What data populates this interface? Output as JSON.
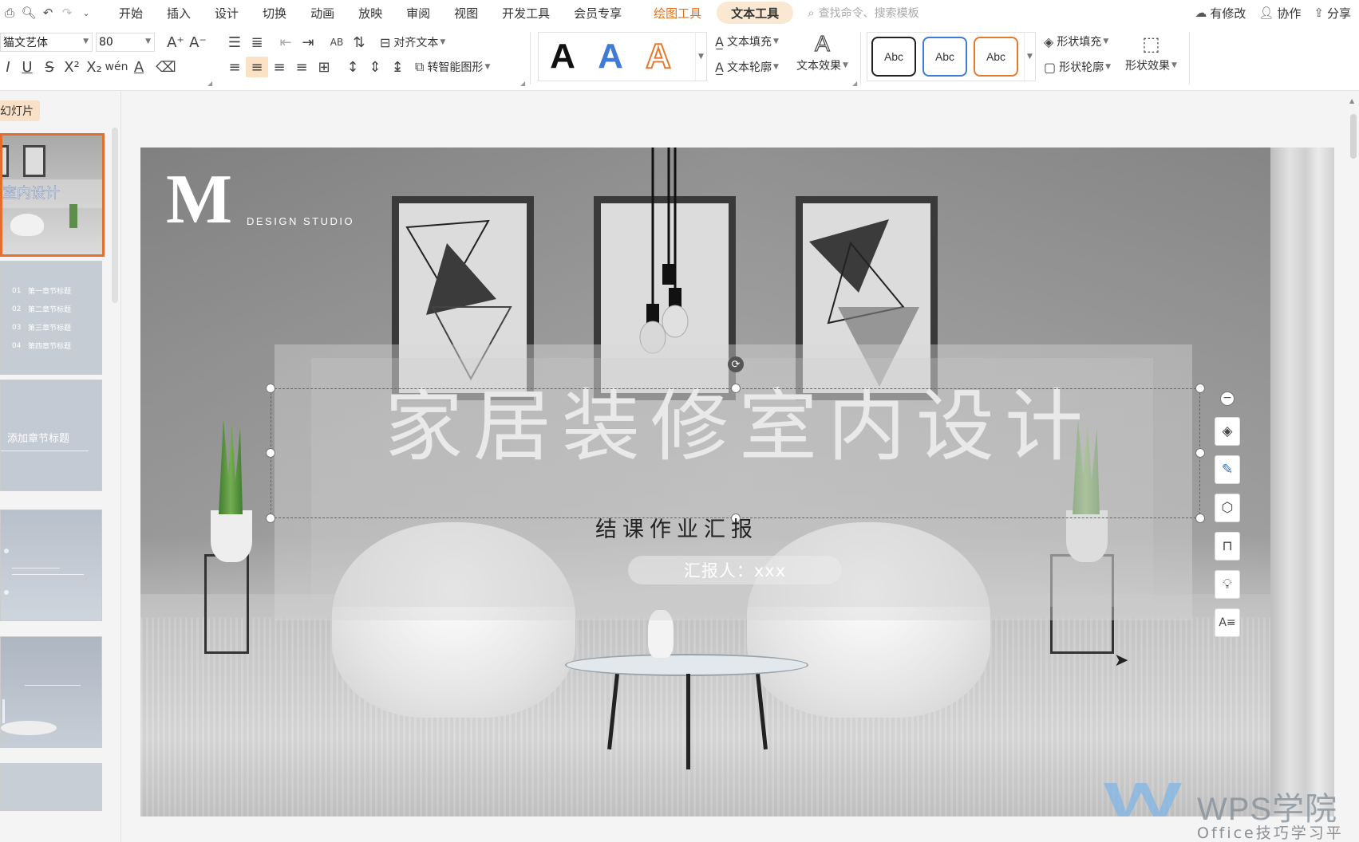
{
  "menu": {
    "items": [
      "开始",
      "插入",
      "设计",
      "切换",
      "动画",
      "放映",
      "审阅",
      "视图",
      "开发工具",
      "会员专享"
    ],
    "drawing_tools": "绘图工具",
    "text_tools": "文本工具",
    "search_placeholder": "查找命令、搜索模板",
    "modified": "有修改",
    "collaborate": "协作",
    "share": "分享"
  },
  "ribbon": {
    "font_name": "猫文艺体",
    "font_size": "80",
    "align_text": "对齐文本",
    "smart_shape": "转智能图形",
    "text_fill": "文本填充",
    "text_outline": "文本轮廓",
    "text_effect": "文本效果",
    "shape_fill": "形状填充",
    "shape_outline": "形状轮廓",
    "shape_effect": "形状效果",
    "abc_label": "Abc",
    "big_a": "A",
    "colors": {
      "black": "#111111",
      "blue": "#3d7bd6",
      "orange": "#e57a2f"
    }
  },
  "panel": {
    "tab_label": "幻灯片",
    "thumb1_title": "室内设计",
    "thumb3_title": "添加章节标题",
    "thumb2_items": [
      "第一章节标题",
      "第二章节标题",
      "第三章节标题",
      "第四章节标题"
    ],
    "thumb2_nums": [
      "01",
      "02",
      "03",
      "04"
    ]
  },
  "slide": {
    "logo_letter": "M",
    "logo_sub": "DESIGN STUDIO",
    "title": "家居装修室内设计",
    "subtitle": "结课作业汇报",
    "reporter": "汇报人：xxx"
  },
  "watermark": {
    "brand": "WPS学院",
    "tagline": "Office技巧学习平台"
  },
  "accent": "#e46f2a"
}
